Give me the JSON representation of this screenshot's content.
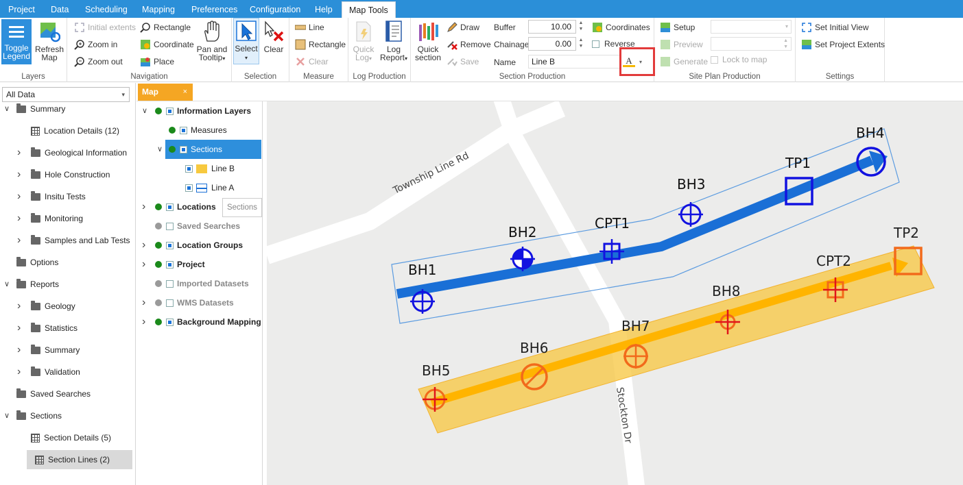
{
  "menu": {
    "items": [
      "Project",
      "Data",
      "Scheduling",
      "Mapping",
      "Preferences",
      "Configuration",
      "Help"
    ],
    "active_tab": "Map Tools"
  },
  "ribbon": {
    "layers": {
      "label": "Layers",
      "toggle_legend": "Toggle Legend",
      "refresh_map": "Refresh Map"
    },
    "navigation": {
      "label": "Navigation",
      "initial_extents": "Initial extents",
      "zoom_in": "Zoom in",
      "zoom_out": "Zoom out",
      "rectangle": "Rectangle",
      "coordinate": "Coordinate",
      "place": "Place",
      "pan_tooltip": "Pan and Tooltip"
    },
    "selection": {
      "label": "Selection",
      "select": "Select",
      "clear": "Clear"
    },
    "measure": {
      "label": "Measure",
      "line": "Line",
      "rectangle": "Rectangle",
      "clear": "Clear"
    },
    "log_production": {
      "label": "Log Production",
      "quick_log": "Quick Log",
      "log_report": "Log Report"
    },
    "section_production": {
      "label": "Section Production",
      "quick_section": "Quick section",
      "draw": "Draw",
      "remove": "Remove",
      "save": "Save",
      "buffer_label": "Buffer",
      "buffer_value": "10.00",
      "chainage_label": "Chainage",
      "chainage_value": "0.00",
      "name_label": "Name",
      "name_value": "Line B",
      "coordinates": "Coordinates",
      "reverse": "Reverse",
      "font_color_glyph": "A"
    },
    "site_plan": {
      "label": "Site Plan Production",
      "setup": "Setup",
      "preview": "Preview",
      "generate": "Generate",
      "lock_to_map": "Lock to map"
    },
    "settings": {
      "label": "Settings",
      "set_initial_view": "Set Initial View",
      "set_project_extents": "Set Project Extents"
    }
  },
  "left_panel": {
    "filter": "All Data",
    "tree": [
      {
        "label": "Summary",
        "type": "folder",
        "chevron": "expanded",
        "level": 0
      },
      {
        "label": "Location Details (12)",
        "type": "grid",
        "level": 1
      },
      {
        "label": "Geological Information",
        "type": "folder",
        "chevron": "collapsed",
        "level": 1
      },
      {
        "label": "Hole Construction",
        "type": "folder",
        "chevron": "collapsed",
        "level": 1
      },
      {
        "label": "Insitu Tests",
        "type": "folder",
        "chevron": "collapsed",
        "level": 1
      },
      {
        "label": "Monitoring",
        "type": "folder",
        "chevron": "collapsed",
        "level": 1
      },
      {
        "label": "Samples and Lab Tests",
        "type": "folder",
        "chevron": "collapsed",
        "level": 1
      },
      {
        "label": "Options",
        "type": "folder",
        "level": 0
      },
      {
        "label": "Reports",
        "type": "folder",
        "chevron": "expanded",
        "level": 0
      },
      {
        "label": "Geology",
        "type": "folder",
        "chevron": "collapsed",
        "level": 1
      },
      {
        "label": "Statistics",
        "type": "folder",
        "chevron": "collapsed",
        "level": 1
      },
      {
        "label": "Summary",
        "type": "folder",
        "chevron": "collapsed",
        "level": 1
      },
      {
        "label": "Validation",
        "type": "folder",
        "chevron": "collapsed",
        "level": 1
      },
      {
        "label": "Saved Searches",
        "type": "folder",
        "level": 0
      },
      {
        "label": "Sections",
        "type": "folder",
        "chevron": "expanded",
        "level": 0
      },
      {
        "label": "Section Details (5)",
        "type": "grid",
        "level": 1
      },
      {
        "label": "Section Lines (2)",
        "type": "grid",
        "level": 1,
        "selected": true
      }
    ]
  },
  "map_tab": {
    "label": "Map",
    "close": "×"
  },
  "legend": {
    "items": [
      {
        "label": "Information Layers",
        "bold": true,
        "dot": "green",
        "checked": true,
        "chevron": "expanded",
        "indent": 0
      },
      {
        "label": "Measures",
        "dot": "green",
        "checked": true,
        "indent": 1
      },
      {
        "label": "Sections",
        "dot": "green",
        "checked": true,
        "chevron": "expanded",
        "indent": 1,
        "selected": true
      },
      {
        "label": "Line B",
        "checked": true,
        "swatch": "#f5b800",
        "indent": 2
      },
      {
        "label": "Line A",
        "checked": true,
        "swatch": "#1a6fd6",
        "indent": 2
      },
      {
        "label": "Locations",
        "bold": true,
        "dot": "green",
        "checked": true,
        "chevron": "collapsed",
        "indent": 0
      },
      {
        "label": "Saved Searches",
        "bold": true,
        "dim": true,
        "dot": "grey",
        "checked": false,
        "indent": 0
      },
      {
        "label": "Location Groups",
        "bold": true,
        "dot": "green",
        "checked": true,
        "chevron": "collapsed",
        "indent": 0
      },
      {
        "label": "Project",
        "bold": true,
        "dot": "green",
        "checked": true,
        "chevron": "collapsed",
        "indent": 0
      },
      {
        "label": "Imported Datasets",
        "bold": true,
        "dim": true,
        "dot": "grey",
        "checked": false,
        "indent": 0
      },
      {
        "label": "WMS Datasets",
        "bold": true,
        "dim": true,
        "dot": "grey",
        "checked": false,
        "chevron": "collapsed",
        "indent": 0
      },
      {
        "label": "Background Mapping",
        "bold": true,
        "dot": "green",
        "checked": true,
        "chevron": "collapsed",
        "indent": 0
      }
    ],
    "tooltip": "Sections"
  },
  "map": {
    "roads": [
      "Township Line Rd",
      "Stockton Dr"
    ],
    "colors": {
      "line_a": "#1a6fd6",
      "line_b": "#ffb400",
      "buffer_b": "#f8c94a",
      "point_a": "#1212e0",
      "point_b": "#f26a1b"
    },
    "points": [
      {
        "name": "BH1",
        "series": "a"
      },
      {
        "name": "BH2",
        "series": "a"
      },
      {
        "name": "CPT1",
        "series": "a"
      },
      {
        "name": "BH3",
        "series": "a"
      },
      {
        "name": "TP1",
        "series": "a"
      },
      {
        "name": "BH4",
        "series": "a"
      },
      {
        "name": "BH5",
        "series": "b"
      },
      {
        "name": "BH6",
        "series": "b"
      },
      {
        "name": "BH7",
        "series": "b"
      },
      {
        "name": "BH8",
        "series": "b"
      },
      {
        "name": "CPT2",
        "series": "b"
      },
      {
        "name": "TP2",
        "series": "b"
      }
    ]
  }
}
